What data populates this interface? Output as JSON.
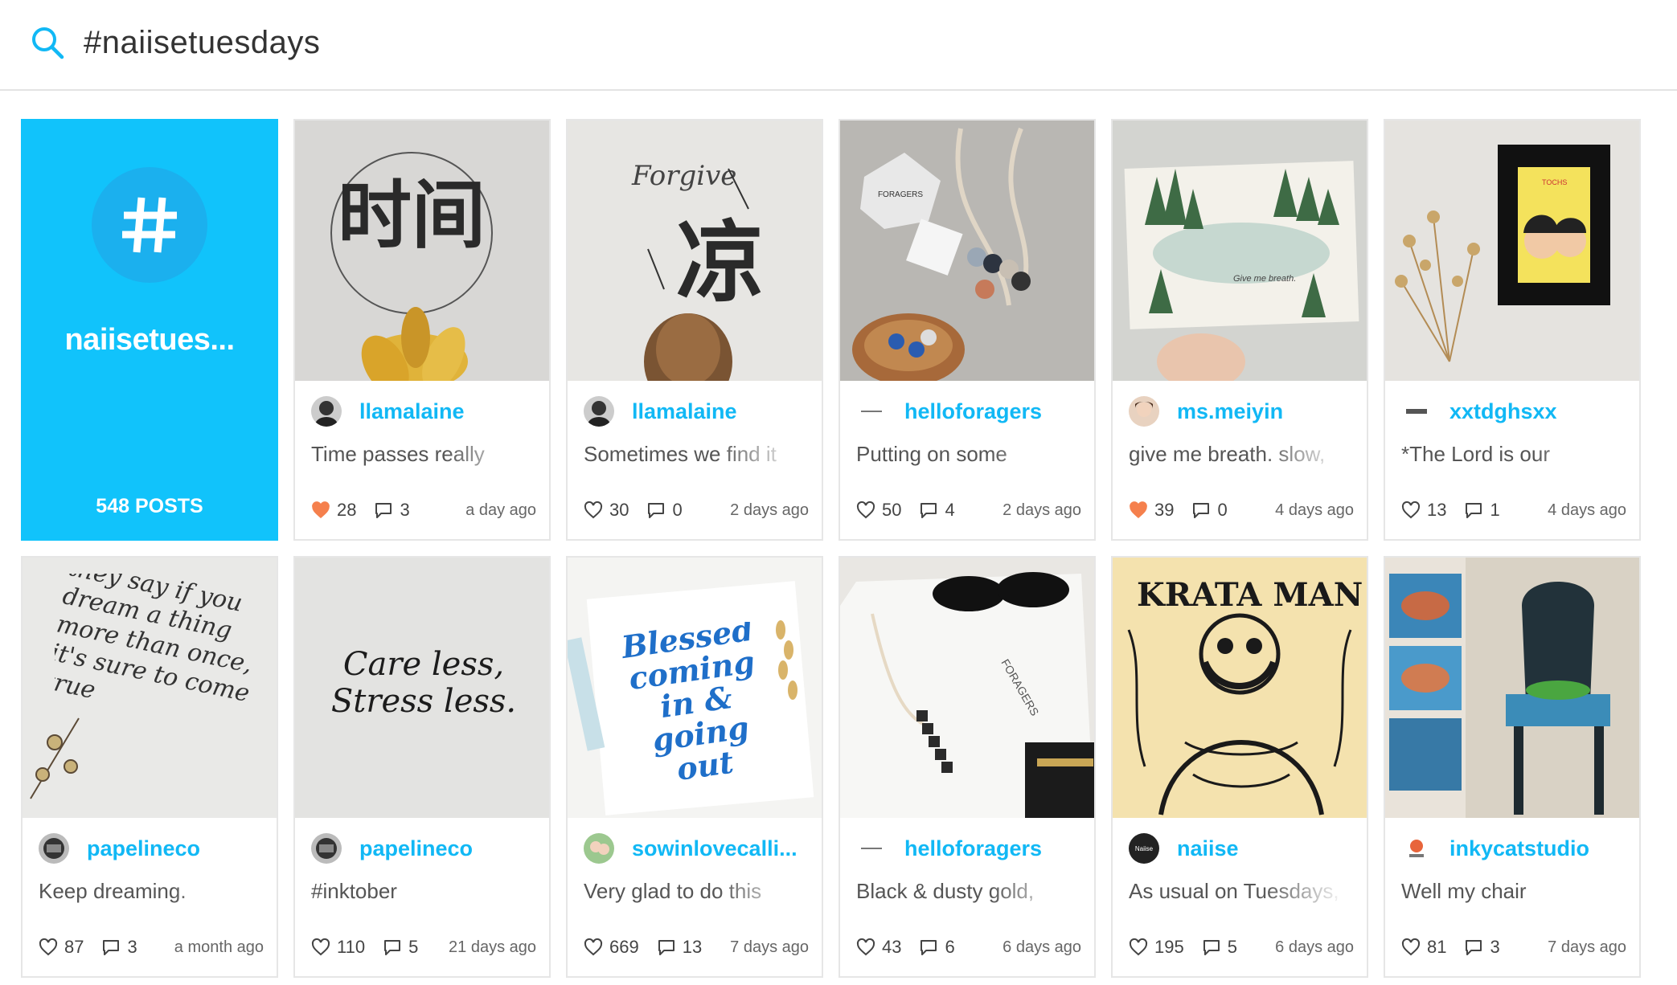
{
  "search": {
    "query": "#naiisetuesdays",
    "accent": "#11c3fb"
  },
  "tag": {
    "name": "naiisetues...",
    "count_label": "548 POSTS",
    "color": "#11c3fb"
  },
  "posts": [
    {
      "user": "llamalaine",
      "caption": "Time passes really",
      "likes": "28",
      "comments": "3",
      "time": "a day ago",
      "liked": true
    },
    {
      "user": "llamalaine",
      "caption": "Sometimes we find it",
      "likes": "30",
      "comments": "0",
      "time": "2 days ago",
      "liked": false
    },
    {
      "user": "helloforagers",
      "caption": "Putting on some",
      "likes": "50",
      "comments": "4",
      "time": "2 days ago",
      "liked": false
    },
    {
      "user": "ms.meiyin",
      "caption": "give me breath. slow,",
      "likes": "39",
      "comments": "0",
      "time": "4 days ago",
      "liked": true
    },
    {
      "user": "xxtdghsxx",
      "caption": "*The Lord is our",
      "likes": "13",
      "comments": "1",
      "time": "4 days ago",
      "liked": false
    },
    {
      "user": "papelineco",
      "caption": "Keep dreaming.",
      "likes": "87",
      "comments": "3",
      "time": "a month ago",
      "liked": false
    },
    {
      "user": "papelineco",
      "caption": "#inktober",
      "likes": "110",
      "comments": "5",
      "time": "21 days ago",
      "liked": false
    },
    {
      "user": "sowinlovecalli...",
      "caption": "Very glad to do this",
      "likes": "669",
      "comments": "13",
      "time": "7 days ago",
      "liked": false
    },
    {
      "user": "helloforagers",
      "caption": "Black & dusty gold,",
      "likes": "43",
      "comments": "6",
      "time": "6 days ago",
      "liked": false
    },
    {
      "user": "naiise",
      "caption": "As usual on Tuesdays,",
      "likes": "195",
      "comments": "5",
      "time": "6 days ago",
      "liked": false
    },
    {
      "user": "inkycatstudio",
      "caption": "Well my chair",
      "likes": "81",
      "comments": "3",
      "time": "7 days ago",
      "liked": false
    }
  ],
  "thumb_text": {
    "p1": "时间",
    "p2": "凉",
    "p2_script": "Forgive",
    "p3": "FORAGERS",
    "p4": "Give me breath.",
    "p5": "TOCHS",
    "p6": "they say if you dream a thing more than once, it's sure to come true",
    "p7": "Care less, Stress less.",
    "p8": "Blessed coming in & going out",
    "p9": "FORAGERS",
    "p10": "KRATA MAN",
    "p11": ""
  }
}
